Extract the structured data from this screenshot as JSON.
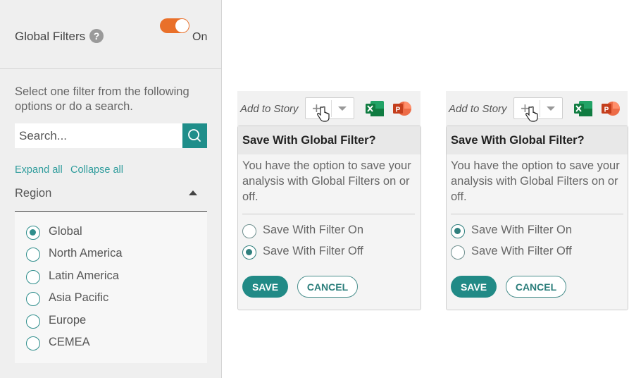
{
  "global_filters": {
    "title": "Global Filters",
    "help_glyph": "?",
    "toggle_label": "On",
    "toggle_state": "on",
    "accent_color": "#e9702a"
  },
  "filter": {
    "instructions": "Select one filter from the following options or do a search.",
    "search_placeholder": "Search...",
    "expand_all": "Expand all",
    "collapse_all": "Collapse all",
    "region_label": "Region",
    "options": [
      {
        "label": "Global",
        "checked": true
      },
      {
        "label": "North America",
        "checked": false
      },
      {
        "label": "Latin America",
        "checked": false
      },
      {
        "label": "Asia Pacific",
        "checked": false
      },
      {
        "label": "Europe",
        "checked": false
      },
      {
        "label": "CEMEA",
        "checked": false
      }
    ],
    "teal_color": "#1f8e8a"
  },
  "dialogs": [
    {
      "add_to_story": "Add to Story",
      "plus_glyph": "+",
      "title": "Save With Global Filter?",
      "body": "You have the option to save your analysis with Global Filters on or off.",
      "option_on": "Save With Filter On",
      "option_off": "Save With Filter Off",
      "selected": "off",
      "save_label": "SAVE",
      "cancel_label": "CANCEL"
    },
    {
      "add_to_story": "Add to Story",
      "plus_glyph": "+",
      "title": "Save With Global Filter?",
      "body": "You have the option to save your analysis with Global Filters on or off.",
      "option_on": "Save With Filter On",
      "option_off": "Save With Filter Off",
      "selected": "on",
      "save_label": "SAVE",
      "cancel_label": "CANCEL"
    }
  ]
}
